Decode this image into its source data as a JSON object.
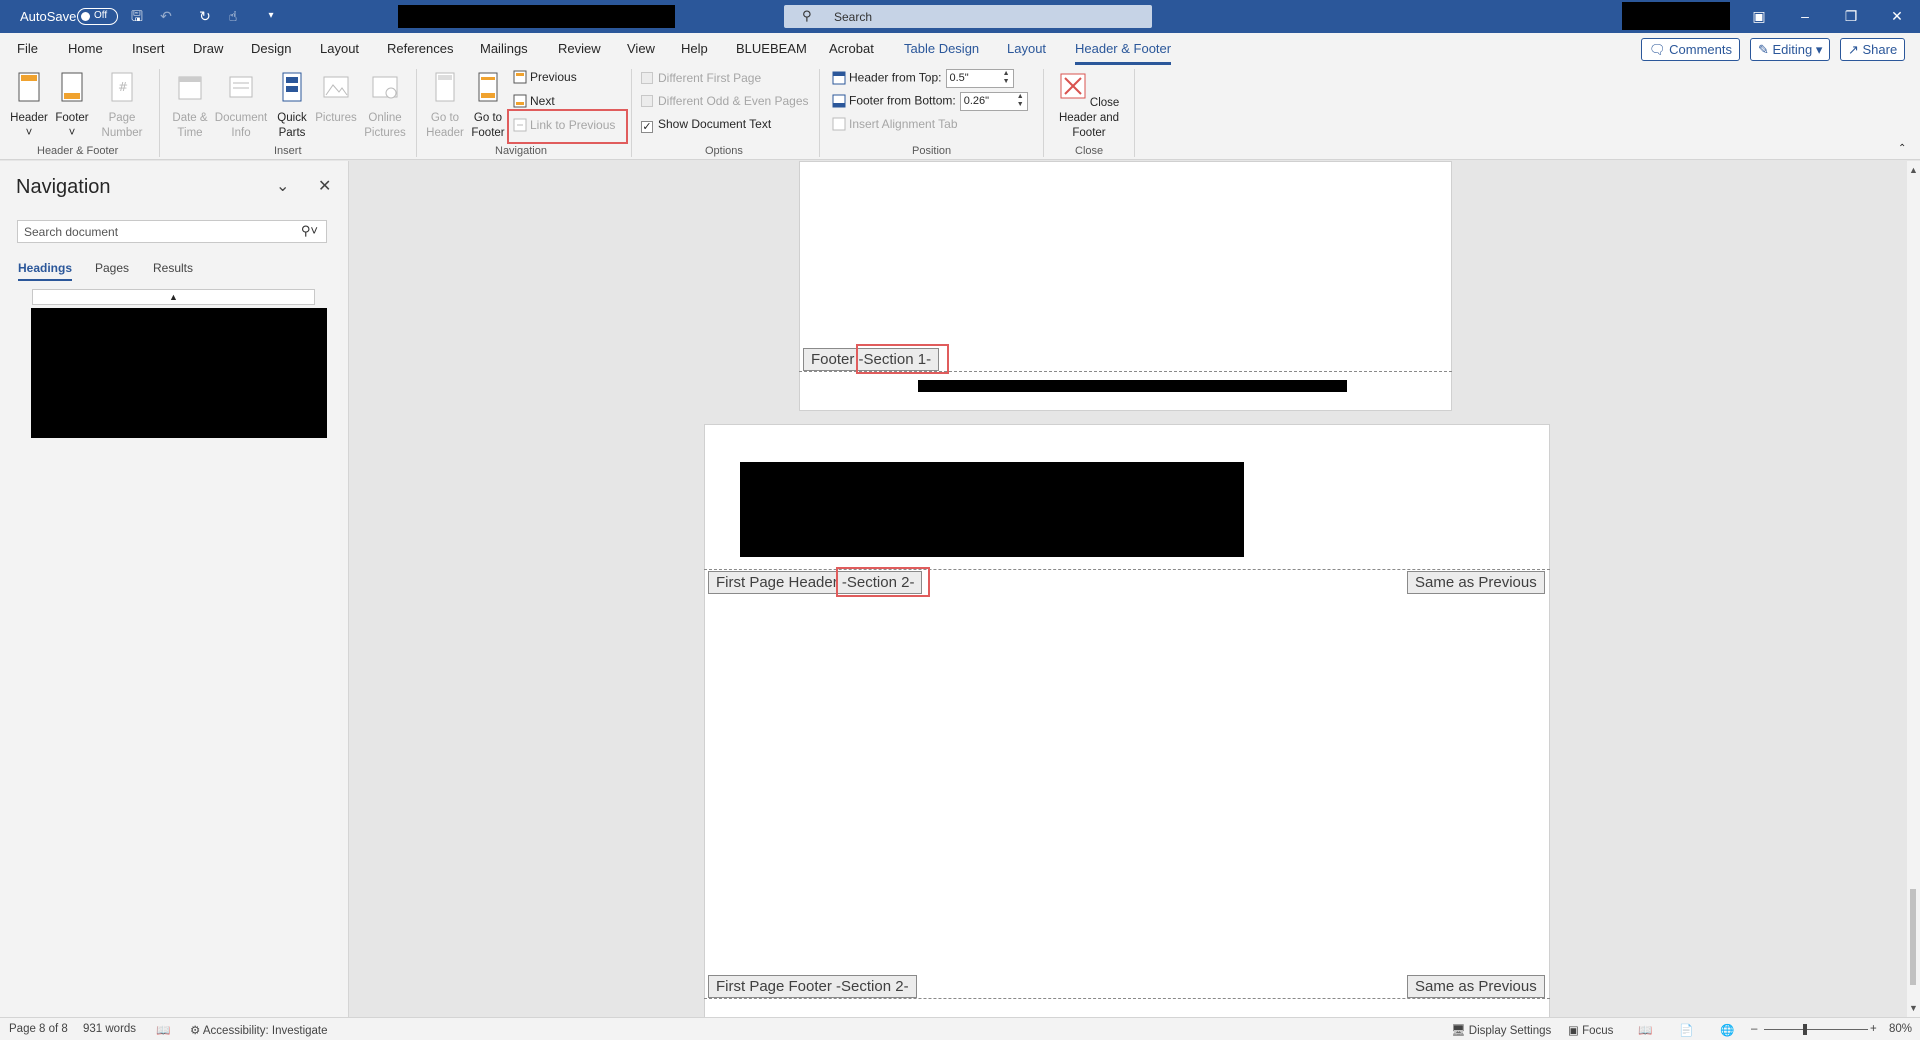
{
  "titlebar": {
    "autosave_label": "AutoSave",
    "autosave_state": "Off",
    "search_placeholder": "Search"
  },
  "tabs": [
    "File",
    "Home",
    "Insert",
    "Draw",
    "Design",
    "Layout",
    "References",
    "Mailings",
    "Review",
    "View",
    "Help",
    "BLUEBEAM",
    "Acrobat",
    "Table Design",
    "Layout",
    "Header & Footer"
  ],
  "top_buttons": {
    "comments": "Comments",
    "editing": "Editing",
    "share": "Share"
  },
  "ribbon": {
    "header": "Header",
    "footer": "Footer",
    "page_number": "Page Number",
    "date_time": "Date & Time",
    "document_info": "Document Info",
    "quick_parts": "Quick Parts",
    "pictures": "Pictures",
    "online_pictures": "Online Pictures",
    "go_to_header": "Go to Header",
    "go_to_footer": "Go to Footer",
    "previous": "Previous",
    "next": "Next",
    "link_to_previous": "Link to Previous",
    "different_first_page": "Different First Page",
    "different_odd_even": "Different Odd & Even Pages",
    "show_document_text": "Show Document Text",
    "header_from_top": "Header from Top:",
    "header_from_top_value": "0.5\"",
    "footer_from_bottom": "Footer from Bottom:",
    "footer_from_bottom_value": "0.26\"",
    "insert_alignment_tab": "Insert Alignment Tab",
    "close_header_footer": "Close Header and Footer",
    "groups": {
      "header_footer": "Header & Footer",
      "insert": "Insert",
      "navigation": "Navigation",
      "options": "Options",
      "position": "Position",
      "close": "Close"
    }
  },
  "nav": {
    "title": "Navigation",
    "search_placeholder": "Search document",
    "tabs": [
      "Headings",
      "Pages",
      "Results"
    ]
  },
  "document": {
    "footer_label": "Footer",
    "footer_section": "-Section 1-",
    "first_header_label": "First Page Header",
    "first_header_section": "-Section 2-",
    "same_as_previous": "Same as Previous",
    "first_footer": "First Page Footer -Section 2-"
  },
  "status": {
    "page": "Page 8 of 8",
    "words": "931 words",
    "accessibility": "Accessibility: Investigate",
    "display_settings": "Display Settings",
    "focus": "Focus",
    "zoom": "80%"
  },
  "colors": {
    "brand": "#2b579a",
    "highlight": "#e05c5c"
  }
}
